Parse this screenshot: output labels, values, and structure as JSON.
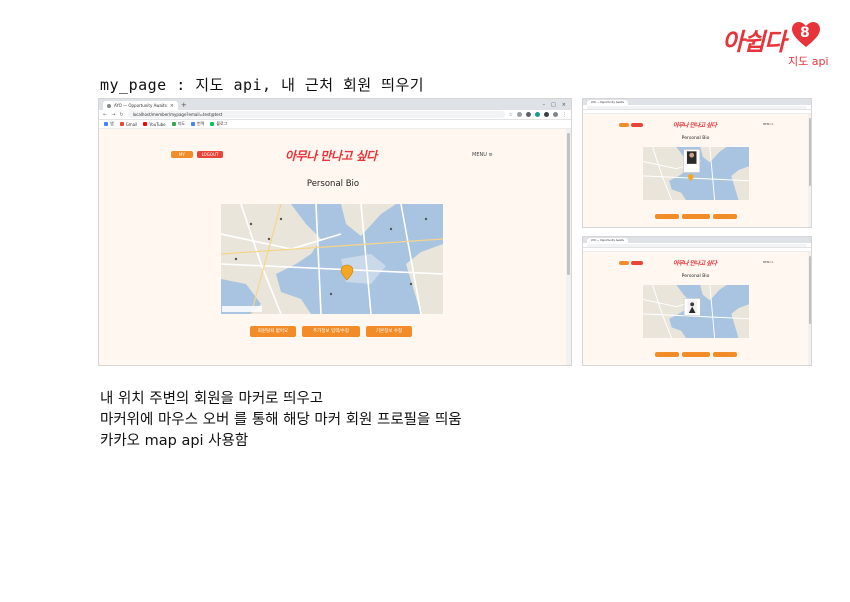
{
  "brand": {
    "logo_text": "아쉽다",
    "number": "8",
    "subtitle": "지도 api"
  },
  "slide": {
    "title": "my_page : 지도 api, 내 근처 회원 띄우기",
    "description": [
      "내 위치 주변의 회원을 마커로 띄우고",
      "마커위에 마우스 오버 를 통해 해당 마커 회원 프로필을 띄움",
      "카카오 map api 사용함"
    ]
  },
  "browser_main": {
    "tab_title": "AYO — Opportunity Awaits",
    "url": "localhost/member/mypage?email=test@test",
    "bookmarks": [
      "앱",
      "Gmail",
      "YouTube",
      "지도",
      "번역",
      "블로그"
    ],
    "site": {
      "login_label": "MY",
      "logout_label": "LOGOUT",
      "logo": "아무나 만나고 싶다",
      "menu_label": "MENU ≡",
      "bio_title": "Personal Bio",
      "buttons": [
        "회원탈퇴 없어요",
        "주가정보 입력/수정",
        "기본정보 수정"
      ]
    }
  },
  "browser_side": {
    "tab_title": "AYO — Opportunity Awaits",
    "bio_title": "Personal Bio",
    "logo": "아무나 만나고 싶다",
    "menu_label": "MENU ≡"
  },
  "colors": {
    "accent": "#e8333a",
    "button": "#f28c28",
    "page_bg": "#fff7f0",
    "sea": "#a9c4e0"
  },
  "icons": [
    "heart-icon",
    "back-icon",
    "forward-icon",
    "reload-icon",
    "map-marker-icon",
    "hamburger-icon"
  ]
}
